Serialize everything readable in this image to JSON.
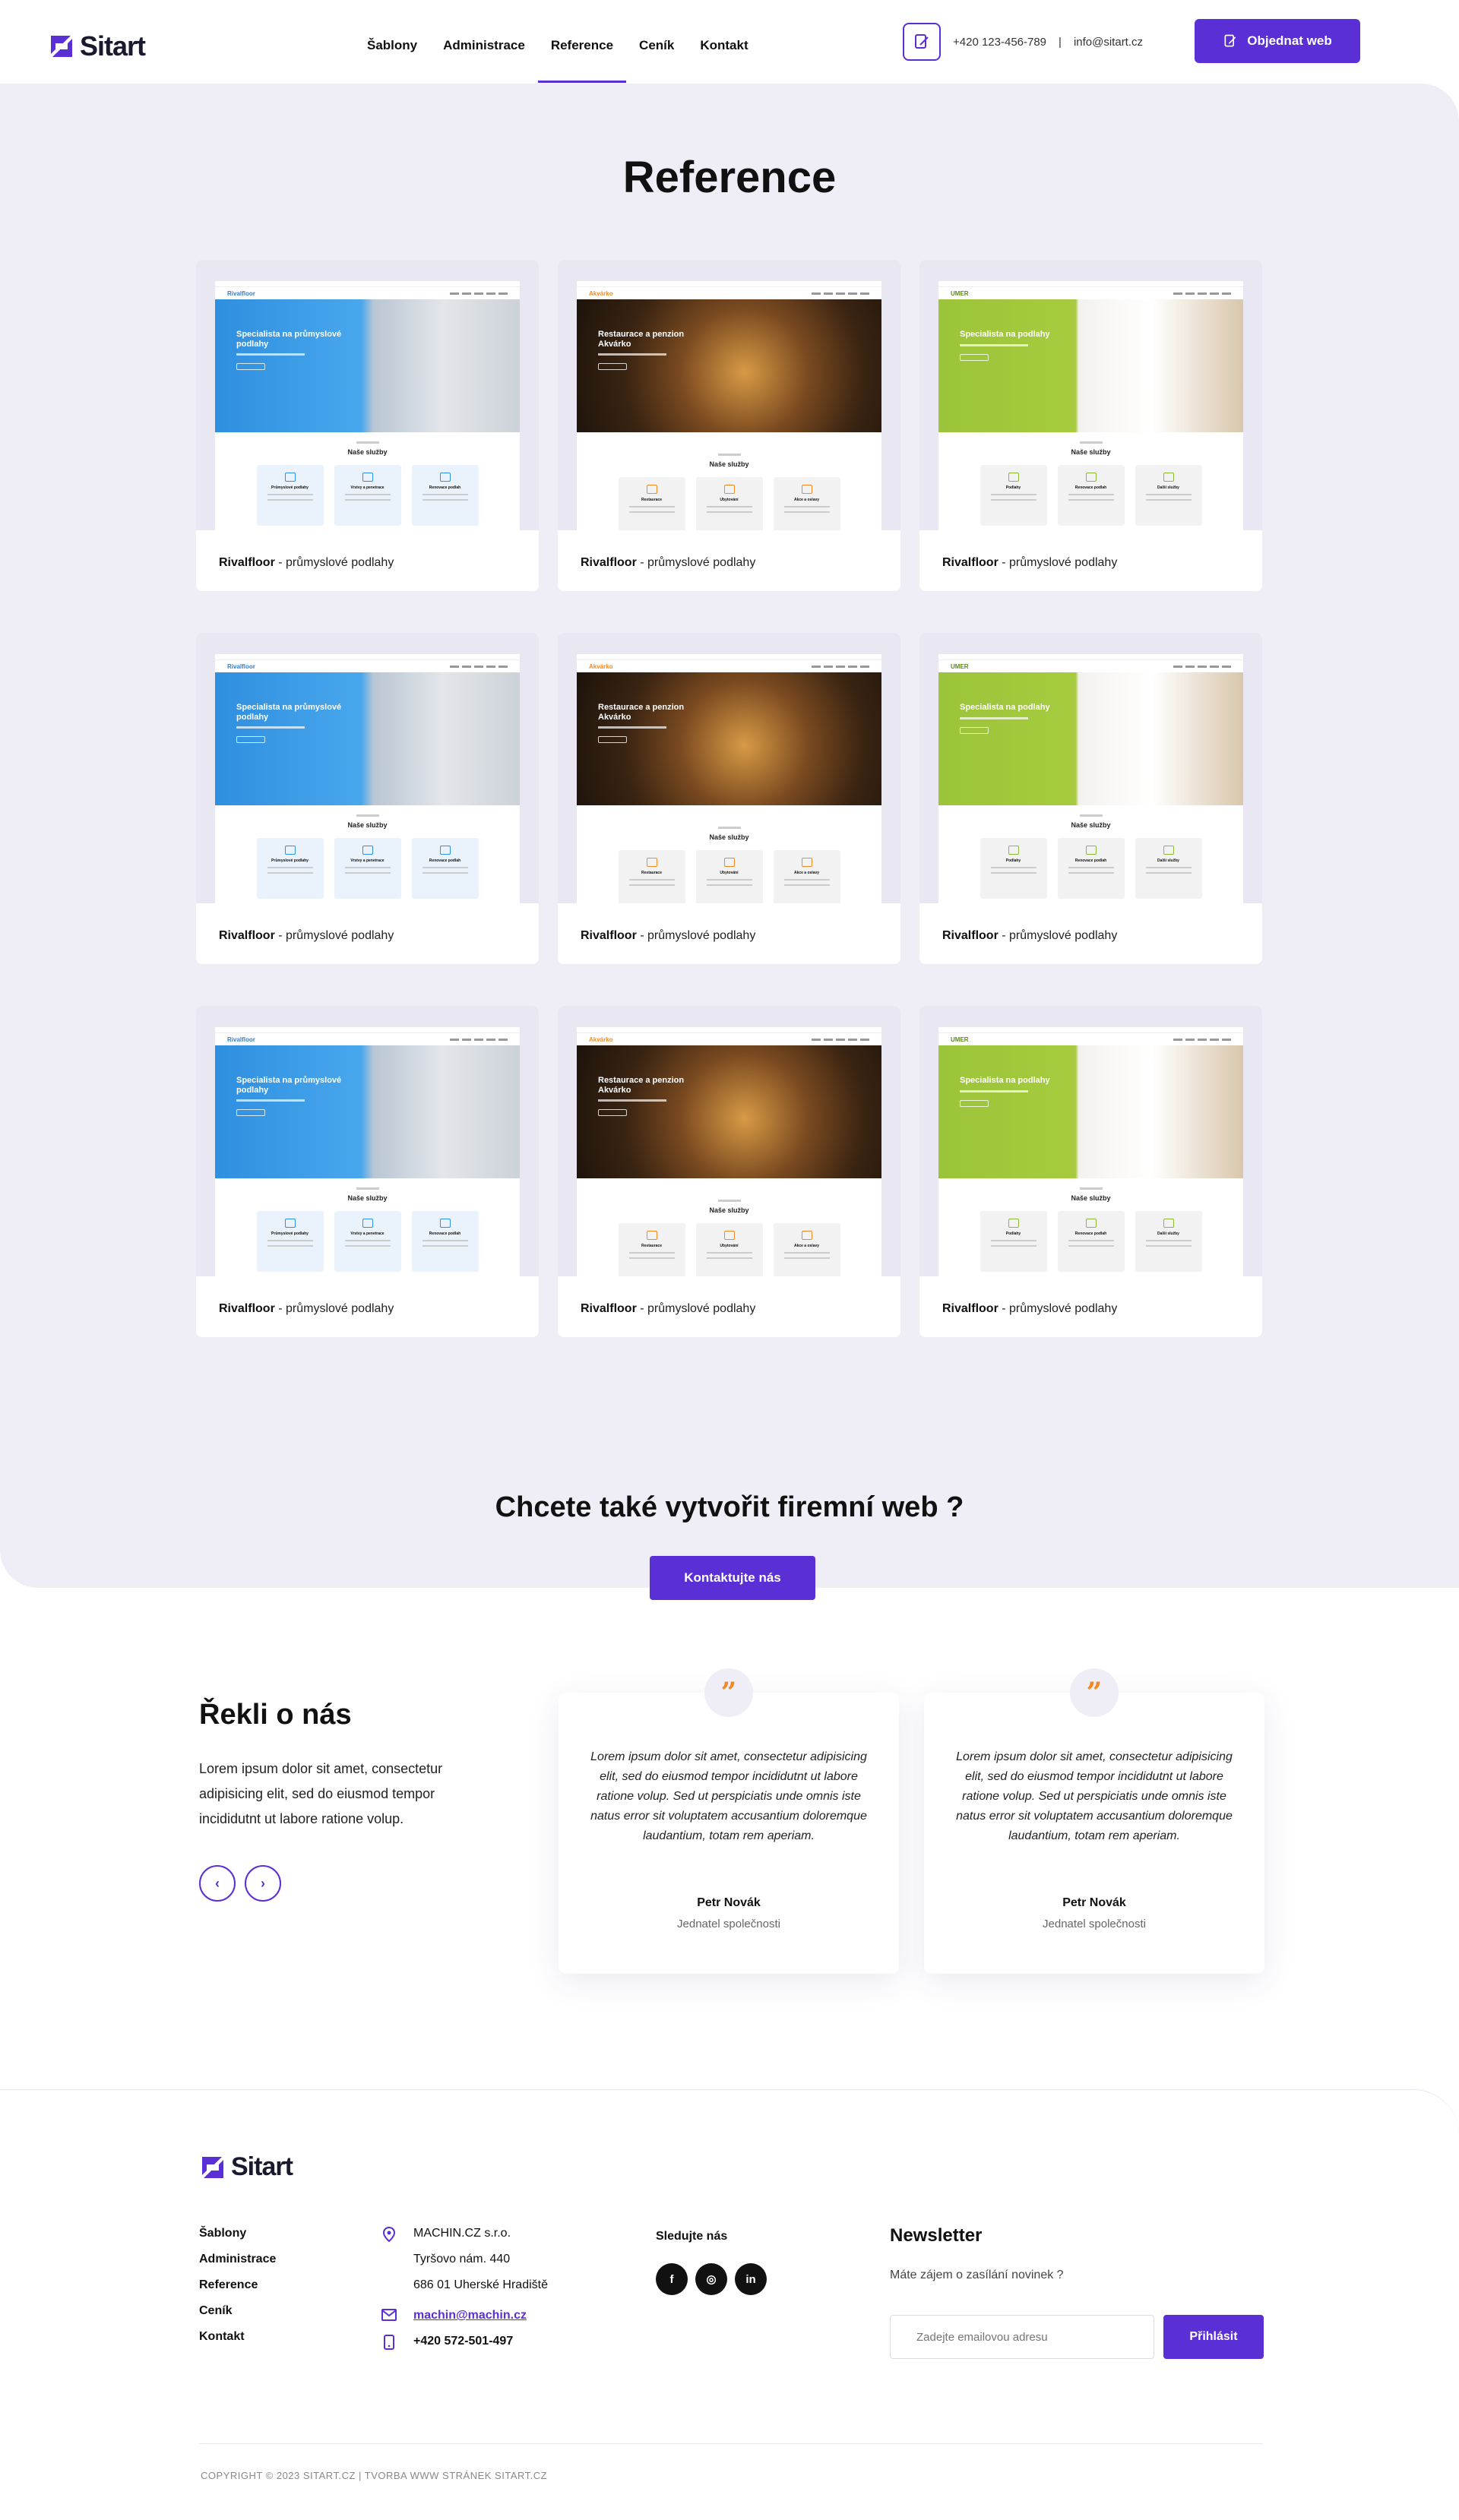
{
  "header": {
    "logo": "Sitart",
    "nav": [
      "Šablony",
      "Administrace",
      "Reference",
      "Ceník",
      "Kontakt"
    ],
    "active_nav": "Reference",
    "phone": "+420 123-456-789",
    "separator": "|",
    "email": "info@sitart.cz",
    "order_button": "Objednat web"
  },
  "reference": {
    "title": "Reference",
    "cards": [
      {
        "theme": "blue",
        "hero": "Specialista na průmyslové podlahy",
        "logo": "Rivalfloor",
        "services": "Naše služby",
        "boxes": [
          "Průmyslové podlahy",
          "Vrstvy a penetrace",
          "Renovace podlah"
        ],
        "name": "Rivalfloor",
        "desc": " - průmyslové podlahy"
      },
      {
        "theme": "brown",
        "hero": "Restaurace a penzion Akvárko",
        "logo": "Akvárko",
        "services": "Naše služby",
        "boxes": [
          "Restaurace",
          "Ubytování",
          "Akce a oslavy"
        ],
        "name": "Rivalfloor",
        "desc": " - průmyslové podlahy"
      },
      {
        "theme": "green",
        "hero": "Specialista na podlahy",
        "logo": "UMER",
        "services": "Naše služby",
        "boxes": [
          "Podlahy",
          "Renovace podlah",
          "Další služby"
        ],
        "name": "Rivalfloor",
        "desc": " - průmyslové podlahy"
      },
      {
        "theme": "blue",
        "hero": "Specialista na průmyslové podlahy",
        "logo": "Rivalfloor",
        "services": "Naše služby",
        "boxes": [
          "Průmyslové podlahy",
          "Vrstvy a penetrace",
          "Renovace podlah"
        ],
        "name": "Rivalfloor",
        "desc": " - průmyslové podlahy"
      },
      {
        "theme": "brown",
        "hero": "Restaurace a penzion Akvárko",
        "logo": "Akvárko",
        "services": "Naše služby",
        "boxes": [
          "Restaurace",
          "Ubytování",
          "Akce a oslavy"
        ],
        "name": "Rivalfloor",
        "desc": " - průmyslové podlahy"
      },
      {
        "theme": "green",
        "hero": "Specialista na podlahy",
        "logo": "UMER",
        "services": "Naše služby",
        "boxes": [
          "Podlahy",
          "Renovace podlah",
          "Další služby"
        ],
        "name": "Rivalfloor",
        "desc": " - průmyslové podlahy"
      },
      {
        "theme": "blue",
        "hero": "Specialista na průmyslové podlahy",
        "logo": "Rivalfloor",
        "services": "Naše služby",
        "boxes": [
          "Průmyslové podlahy",
          "Vrstvy a penetrace",
          "Renovace podlah"
        ],
        "name": "Rivalfloor",
        "desc": " - průmyslové podlahy"
      },
      {
        "theme": "brown",
        "hero": "Restaurace a penzion Akvárko",
        "logo": "Akvárko",
        "services": "Naše služby",
        "boxes": [
          "Restaurace",
          "Ubytování",
          "Akce a oslavy"
        ],
        "name": "Rivalfloor",
        "desc": " - průmyslové podlahy"
      },
      {
        "theme": "green",
        "hero": "Specialista na podlahy",
        "logo": "UMER",
        "services": "Naše služby",
        "boxes": [
          "Podlahy",
          "Renovace podlah",
          "Další služby"
        ],
        "name": "Rivalfloor",
        "desc": " - průmyslové podlahy"
      }
    ],
    "cta_title": "Chcete také vytvořit firemní web ?",
    "cta_button": "Kontaktujte nás"
  },
  "testimonials": {
    "title": "Řekli o nás",
    "text": "Lorem ipsum dolor sit amet, consectetur adipisicing elit, sed do eiusmod tempor incididutnt ut labore ratione volup.",
    "prev_icon": "chevron-left-icon",
    "next_icon": "chevron-right-icon",
    "items": [
      {
        "quote": "Lorem ipsum dolor sit amet, consectetur adipisicing elit, sed do eiusmod tempor incididutnt ut labore ratione volup. Sed ut perspiciatis unde omnis iste natus error sit voluptatem accusantium doloremque laudantium, totam rem aperiam.",
        "name": "Petr Novák",
        "role": "Jednatel společnosti"
      },
      {
        "quote": "Lorem ipsum dolor sit amet, consectetur adipisicing elit, sed do eiusmod tempor incididutnt ut labore ratione volup. Sed ut perspiciatis unde omnis iste natus error sit voluptatem accusantium doloremque laudantium, totam rem aperiam.",
        "name": "Petr Novák",
        "role": "Jednatel společnosti"
      }
    ]
  },
  "footer": {
    "logo": "Sitart",
    "links": [
      "Šablony",
      "Administrace",
      "Reference",
      "Ceník",
      "Kontakt"
    ],
    "company": "MACHIN.CZ s.r.o.",
    "street": "Tyršovo nám. 440",
    "city": "686 01 Uherské Hradiště",
    "email": "machin@machin.cz",
    "phone": "+420 572-501-497",
    "social_title": "Sledujte nás",
    "social": [
      "f",
      "◎",
      "in"
    ],
    "newsletter_title": "Newsletter",
    "newsletter_sub": "Máte zájem o zasílání novinek ?",
    "newsletter_placeholder": "Zadejte emailovou adresu",
    "newsletter_button": "Přihlásit",
    "copyright": "COPYRIGHT © 2023 SITART.CZ  |  TVORBA WWW STRÁNEK SITART.CZ"
  },
  "colors": {
    "accent": "#5b2fd6",
    "quote": "#f08a24",
    "section_bg": "#efeef6"
  }
}
